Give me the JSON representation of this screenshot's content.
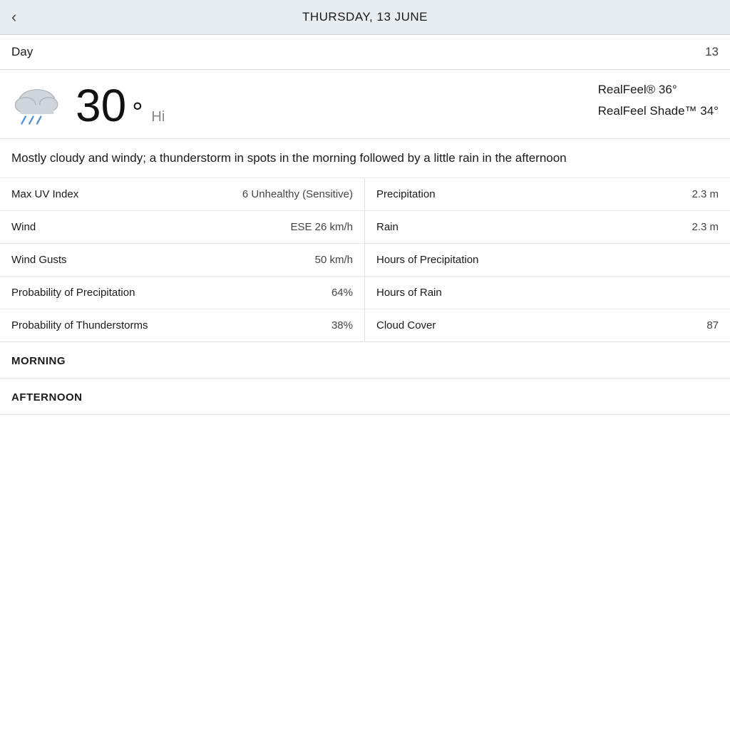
{
  "topbar": {
    "back_label": "‹",
    "title": "THURSDAY, 13 JUNE"
  },
  "section_header": {
    "label": "Day",
    "value": "13"
  },
  "weather": {
    "temperature": "30",
    "temp_unit": "°",
    "temp_type": "Hi",
    "realfeel": "RealFeel® 36°",
    "realfeel_shade": "RealFeel Shade™ 34°",
    "description": "Mostly cloudy and windy; a thunderstorm in spots in the morning followed by a little rain in the afternoon"
  },
  "details": {
    "left": [
      {
        "label": "Max UV Index",
        "value": "6 Unhealthy (Sensitive)"
      },
      {
        "label": "Wind",
        "value": "ESE 26 km/h"
      },
      {
        "label": "Wind Gusts",
        "value": "50 km/h"
      },
      {
        "label": "Probability of Precipitation",
        "value": "64%"
      },
      {
        "label": "Probability of Thunderstorms",
        "value": "38%"
      }
    ],
    "right": [
      {
        "label": "Precipitation",
        "value": "2.3 m"
      },
      {
        "label": "Rain",
        "value": "2.3 m"
      },
      {
        "label": "Hours of Precipitation",
        "value": ""
      },
      {
        "label": "Hours of Rain",
        "value": ""
      },
      {
        "label": "Cloud Cover",
        "value": "87"
      }
    ]
  },
  "time_sections": [
    {
      "label": "MORNING"
    },
    {
      "label": "AFTERNOON"
    }
  ]
}
